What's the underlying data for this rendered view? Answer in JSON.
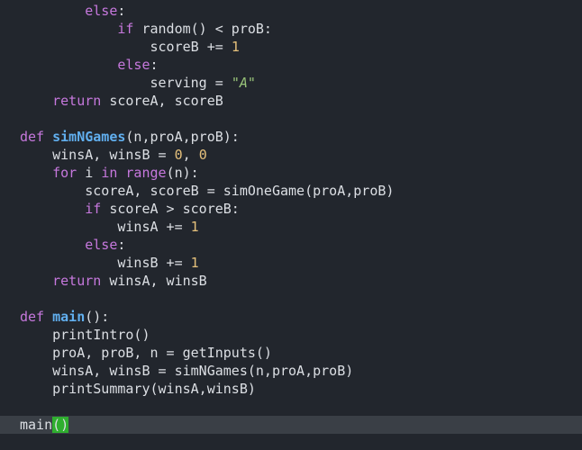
{
  "editor": {
    "colors": {
      "background": "#22262d",
      "cursor_line": "#3a3f46",
      "keyword": "#c678dd",
      "function": "#61afef",
      "number": "#e5c07b",
      "string": "#98c379",
      "text": "#dcdfe4",
      "bracket_match": "#2fae2f"
    },
    "lines": [
      {
        "indent": "        ",
        "tokens": [
          {
            "t": "else",
            "c": "kw"
          },
          {
            "t": ":",
            "c": "op"
          }
        ]
      },
      {
        "indent": "            ",
        "tokens": [
          {
            "t": "if",
            "c": "kw"
          },
          {
            "t": " random() < proB:",
            "c": "id"
          }
        ]
      },
      {
        "indent": "                ",
        "tokens": [
          {
            "t": "scoreB += ",
            "c": "id"
          },
          {
            "t": "1",
            "c": "num"
          }
        ]
      },
      {
        "indent": "            ",
        "tokens": [
          {
            "t": "else",
            "c": "kw"
          },
          {
            "t": ":",
            "c": "op"
          }
        ]
      },
      {
        "indent": "                ",
        "tokens": [
          {
            "t": "serving = ",
            "c": "id"
          },
          {
            "t": "\"A\"",
            "c": "str"
          }
        ]
      },
      {
        "indent": "    ",
        "tokens": [
          {
            "t": "return",
            "c": "kw"
          },
          {
            "t": " scoreA, scoreB",
            "c": "id"
          }
        ]
      },
      {
        "indent": "",
        "tokens": []
      },
      {
        "indent": "",
        "tokens": [
          {
            "t": "def",
            "c": "kw"
          },
          {
            "t": " ",
            "c": "id"
          },
          {
            "t": "simNGames",
            "c": "fn"
          },
          {
            "t": "(n,proA,proB):",
            "c": "id"
          }
        ]
      },
      {
        "indent": "    ",
        "tokens": [
          {
            "t": "winsA, winsB = ",
            "c": "id"
          },
          {
            "t": "0",
            "c": "num"
          },
          {
            "t": ", ",
            "c": "id"
          },
          {
            "t": "0",
            "c": "num"
          }
        ]
      },
      {
        "indent": "    ",
        "tokens": [
          {
            "t": "for",
            "c": "kw"
          },
          {
            "t": " i ",
            "c": "id"
          },
          {
            "t": "in",
            "c": "kw"
          },
          {
            "t": " ",
            "c": "id"
          },
          {
            "t": "range",
            "c": "kw"
          },
          {
            "t": "(n):",
            "c": "id"
          }
        ]
      },
      {
        "indent": "        ",
        "tokens": [
          {
            "t": "scoreA, scoreB = simOneGame(proA,proB)",
            "c": "id"
          }
        ]
      },
      {
        "indent": "        ",
        "tokens": [
          {
            "t": "if",
            "c": "kw"
          },
          {
            "t": " scoreA > scoreB:",
            "c": "id"
          }
        ]
      },
      {
        "indent": "            ",
        "tokens": [
          {
            "t": "winsA += ",
            "c": "id"
          },
          {
            "t": "1",
            "c": "num"
          }
        ]
      },
      {
        "indent": "        ",
        "tokens": [
          {
            "t": "else",
            "c": "kw"
          },
          {
            "t": ":",
            "c": "op"
          }
        ]
      },
      {
        "indent": "            ",
        "tokens": [
          {
            "t": "winsB += ",
            "c": "id"
          },
          {
            "t": "1",
            "c": "num"
          }
        ]
      },
      {
        "indent": "    ",
        "tokens": [
          {
            "t": "return",
            "c": "kw"
          },
          {
            "t": " winsA, winsB",
            "c": "id"
          }
        ]
      },
      {
        "indent": "",
        "tokens": []
      },
      {
        "indent": "",
        "tokens": [
          {
            "t": "def",
            "c": "kw"
          },
          {
            "t": " ",
            "c": "id"
          },
          {
            "t": "main",
            "c": "fn"
          },
          {
            "t": "():",
            "c": "id"
          }
        ]
      },
      {
        "indent": "    ",
        "tokens": [
          {
            "t": "printIntro()",
            "c": "id"
          }
        ]
      },
      {
        "indent": "    ",
        "tokens": [
          {
            "t": "proA, proB, n = getInputs()",
            "c": "id"
          }
        ]
      },
      {
        "indent": "    ",
        "tokens": [
          {
            "t": "winsA, winsB = simNGames(n,proA,proB)",
            "c": "id"
          }
        ]
      },
      {
        "indent": "    ",
        "tokens": [
          {
            "t": "printSummary(winsA,winsB)",
            "c": "id"
          }
        ]
      },
      {
        "indent": "",
        "tokens": []
      },
      {
        "indent": "",
        "cursor": true,
        "tokens": [
          {
            "t": "main",
            "c": "id"
          },
          {
            "t": "()",
            "c": "bracket-match"
          }
        ]
      }
    ]
  }
}
